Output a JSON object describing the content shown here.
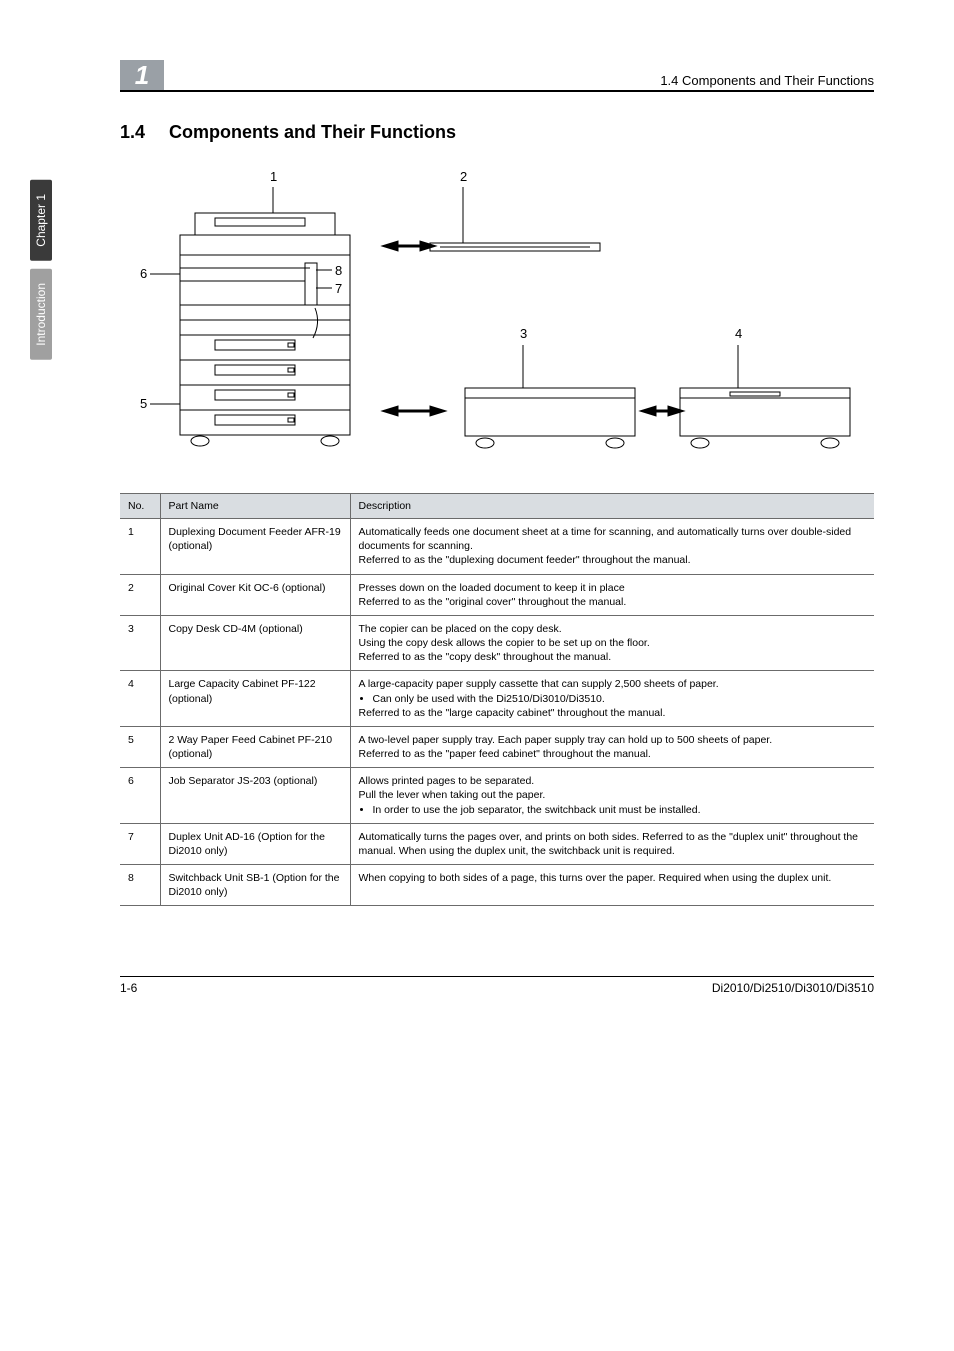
{
  "sidebar": {
    "chapter_tab": "Chapter 1",
    "section_tab": "Introduction"
  },
  "header": {
    "chapter_number": "1",
    "running_title": "1.4 Components and Their Functions"
  },
  "section": {
    "number": "1.4",
    "title": "Components and Their Functions"
  },
  "diagram": {
    "callouts": {
      "c1": "1",
      "c2": "2",
      "c3": "3",
      "c4": "4",
      "c5": "5",
      "c6": "6",
      "c7": "7",
      "c8": "8"
    }
  },
  "table": {
    "headers": {
      "no": "No.",
      "part": "Part Name",
      "desc": "Description"
    },
    "rows": [
      {
        "no": "1",
        "part": "Duplexing Document Feeder AFR-19 (optional)",
        "desc": "Automatically feeds one document sheet at a time for scanning, and automatically turns over double-sided documents for scanning.\nReferred to as the \"duplexing document feeder\" throughout the manual."
      },
      {
        "no": "2",
        "part": "Original Cover Kit OC-6 (optional)",
        "desc": "Presses down on the loaded document to keep it in place\nReferred to as the \"original cover\" throughout the manual."
      },
      {
        "no": "3",
        "part": "Copy Desk CD-4M (optional)",
        "desc": "The copier can be placed on the copy desk.\nUsing the copy desk allows the copier to be set up on the floor.\nReferred to as the \"copy desk\" throughout the manual."
      },
      {
        "no": "4",
        "part": "Large Capacity Cabinet PF-122 (optional)",
        "desc_pre": "A large-capacity paper supply cassette that can supply 2,500 sheets of paper.",
        "desc_bullet": "Can only be used with the Di2510/Di3010/Di3510.",
        "desc_post": "Referred to as the \"large capacity cabinet\" throughout the manual."
      },
      {
        "no": "5",
        "part": "2 Way Paper Feed Cabinet PF-210 (optional)",
        "desc": "A two-level paper supply tray. Each paper supply tray can hold up to 500 sheets of paper.\nReferred to as the \"paper feed cabinet\" throughout the manual."
      },
      {
        "no": "6",
        "part": "Job Separator JS-203 (optional)",
        "desc_pre": "Allows printed pages to be separated.\nPull the lever when taking out the paper.",
        "desc_bullet": "In order to use the job separator, the switchback unit must be installed."
      },
      {
        "no": "7",
        "part": "Duplex Unit AD-16 (Option for the Di2010 only)",
        "desc": "Automatically turns the pages over, and prints on both sides. Referred to as the \"duplex unit\" throughout the manual. When using the duplex unit, the switchback unit is required."
      },
      {
        "no": "8",
        "part": "Switchback Unit SB-1 (Option for the Di2010 only)",
        "desc": "When copying to both sides of a page, this turns over the paper. Required when using the duplex unit."
      }
    ]
  },
  "footer": {
    "page": "1-6",
    "models": "Di2010/Di2510/Di3010/Di3510"
  }
}
